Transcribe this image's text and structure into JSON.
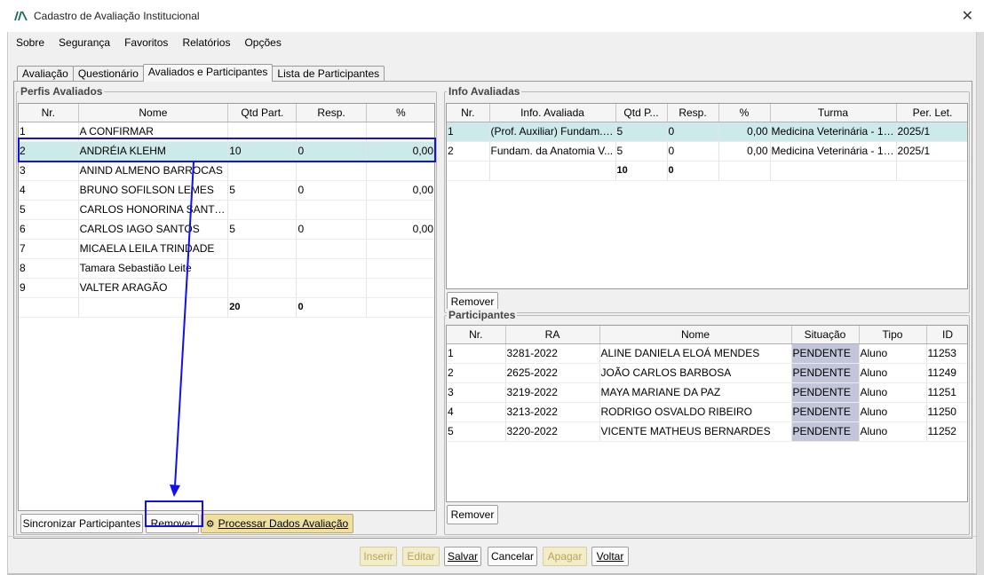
{
  "window": {
    "title": "Cadastro de Avaliação Institucional",
    "close_glyph": "✕"
  },
  "menu": [
    "Sobre",
    "Segurança",
    "Favoritos",
    "Relatórios",
    "Opções"
  ],
  "tabs": [
    "Avaliação",
    "Questionário",
    "Avaliados e Participantes",
    "Lista de Participantes"
  ],
  "active_tab": 2,
  "perfis": {
    "title": "Perfis Avaliados",
    "columns": [
      "Nr.",
      "Nome",
      "Qtd Part.",
      "Resp.",
      "%"
    ],
    "rows": [
      [
        "1",
        "A CONFIRMAR",
        "",
        "",
        ""
      ],
      [
        "2",
        "ANDRÉIA KLEHM",
        "10",
        "0",
        "0,00"
      ],
      [
        "3",
        "ANIND ALMENO BARROCAS",
        "",
        "",
        ""
      ],
      [
        "4",
        "BRUNO SOFILSON LEMES",
        "5",
        "0",
        "0,00"
      ],
      [
        "5",
        "CARLOS HONORINA SANTOS",
        "",
        "",
        ""
      ],
      [
        "6",
        "CARLOS IAGO SANTOS",
        "5",
        "0",
        "0,00"
      ],
      [
        "7",
        "MICAELA LEILA TRINDADE",
        "",
        "",
        ""
      ],
      [
        "8",
        "Tamara Sebastião Leite",
        "",
        "",
        ""
      ],
      [
        "9",
        "VALTER ARAGÃO",
        "",
        "",
        ""
      ]
    ],
    "selected_row": 1,
    "totals": [
      "",
      "",
      "20",
      "0",
      ""
    ],
    "buttons": {
      "sync": "Sincronizar Participantes",
      "remove": "Remover",
      "process": "Processar Dados Avaliação"
    }
  },
  "info": {
    "title": "Info Avaliadas",
    "columns": [
      "Nr.",
      "Info. Avaliada",
      "Qtd P...",
      "Resp.",
      "%",
      "Turma",
      "Per. Let."
    ],
    "rows": [
      [
        "1",
        "(Prof. Auxiliar) Fundam. ...",
        "5",
        "0",
        "0,00",
        "Medicina Veterinária - 1º...",
        "2025/1"
      ],
      [
        "2",
        "Fundam. da Anatomia V...",
        "5",
        "0",
        "0,00",
        "Medicina Veterinária - 1º...",
        "2025/1"
      ]
    ],
    "selected_row": 0,
    "totals": [
      "",
      "",
      "10",
      "0",
      "",
      "",
      ""
    ],
    "remove_button": "Remover"
  },
  "participantes": {
    "title": "Participantes",
    "columns": [
      "Nr.",
      "RA",
      "Nome",
      "Situação",
      "Tipo",
      "ID"
    ],
    "rows": [
      [
        "1",
        "3281-2022",
        "ALINE DANIELA ELOÁ MENDES",
        "PENDENTE",
        "Aluno",
        "11253"
      ],
      [
        "2",
        "2625-2022",
        "JOÃO CARLOS BARBOSA",
        "PENDENTE",
        "Aluno",
        "11249"
      ],
      [
        "3",
        "3219-2022",
        "MAYA MARIANE DA PAZ",
        "PENDENTE",
        "Aluno",
        "11251"
      ],
      [
        "4",
        "3213-2022",
        "RODRIGO OSVALDO RIBEIRO",
        "PENDENTE",
        "Aluno",
        "11250"
      ],
      [
        "5",
        "3220-2022",
        "VICENTE MATHEUS BERNARDES",
        "PENDENTE",
        "Aluno",
        "11252"
      ]
    ],
    "remove_button": "Remover"
  },
  "bottom_buttons": {
    "inserir": "Inserir",
    "editar": "Editar",
    "salvar": "Salvar",
    "cancelar": "Cancelar",
    "apagar": "Apagar",
    "voltar": "Voltar"
  },
  "colors": {
    "selection": "#cdeaea",
    "pending": "#c3c6db",
    "annotation": "#1111ee",
    "process_button": "#f0e0a0"
  }
}
